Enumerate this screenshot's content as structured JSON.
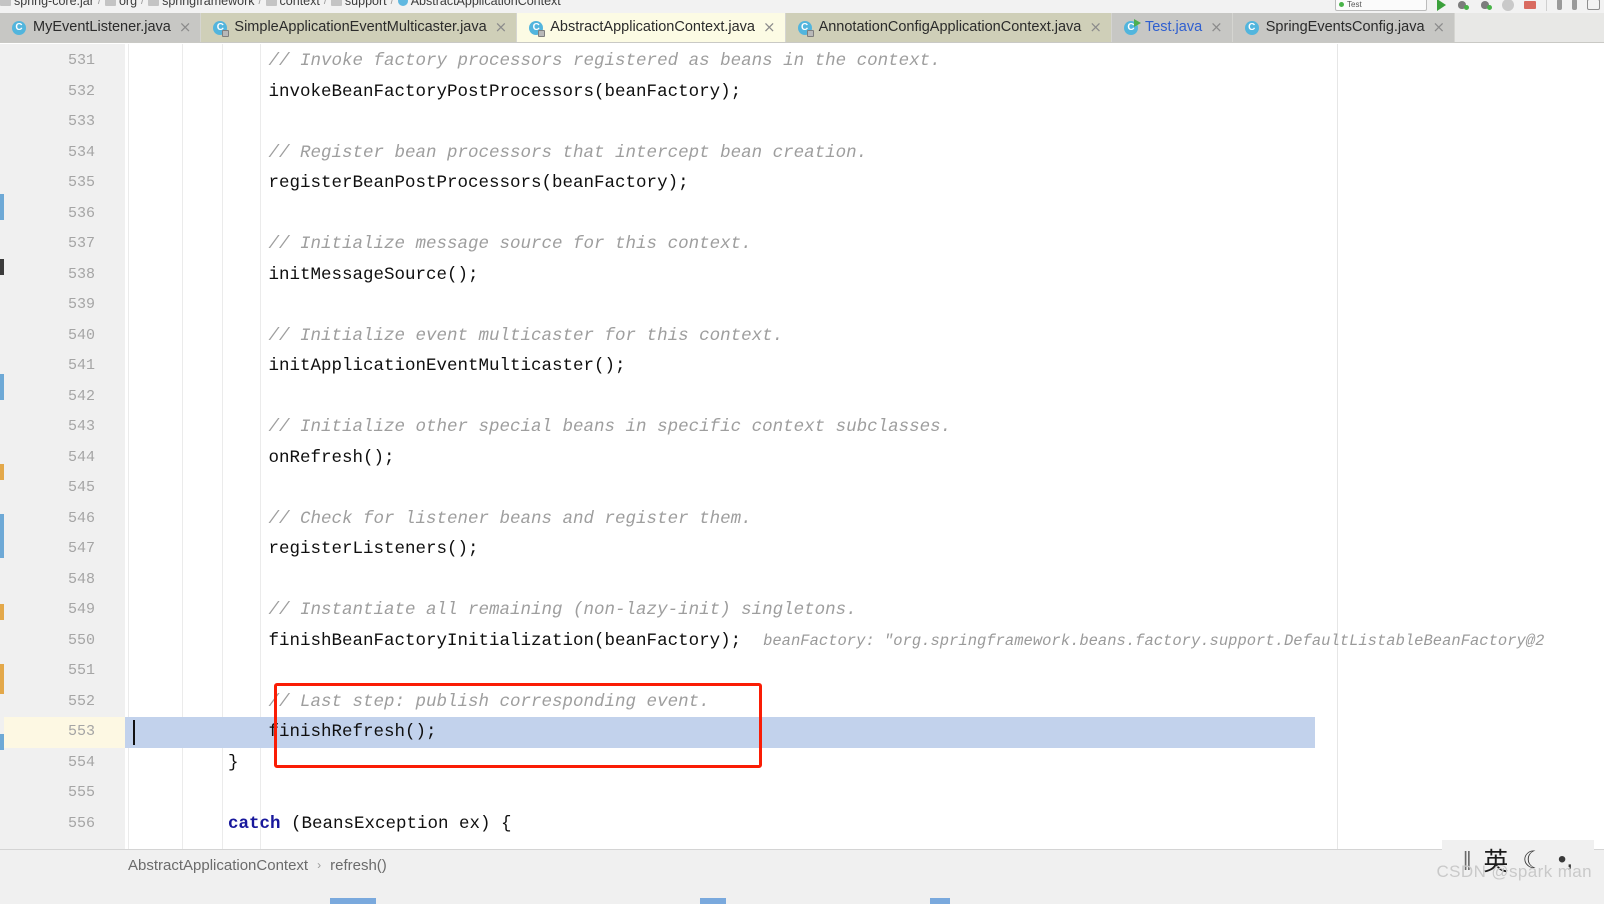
{
  "window": {
    "app": "IntelliJ IDEA",
    "top_breadcrumb": [
      {
        "label": "spring-core.jar",
        "icon": "jar-icon"
      },
      {
        "label": "org",
        "icon": "folder-icon"
      },
      {
        "label": "springframework",
        "icon": "folder-icon"
      },
      {
        "label": "context",
        "icon": "folder-icon"
      },
      {
        "label": "support",
        "icon": "folder-icon"
      },
      {
        "label": "AbstractApplicationContext",
        "icon": "class-icon"
      }
    ],
    "toolbar": {
      "run_config_label": "Test",
      "run_button": "run-icon",
      "debug_button": "debug-icon",
      "coverage_button": "coverage-icon",
      "profile_button": "profile-icon",
      "stop_button": "stop-icon",
      "pin_button": "pin-icon",
      "minimize_button": "minimize-icon",
      "layout_button": "layout-icon"
    }
  },
  "tabs": [
    {
      "label": "MyEventListener.java",
      "icon": "java-class-icon",
      "state": "inactive",
      "style": "gray",
      "is_test": false,
      "closable": true
    },
    {
      "label": "SimpleApplicationEventMulticaster.java",
      "icon": "java-class-locked-icon",
      "state": "inactive",
      "style": "olive",
      "is_test": false,
      "closable": true
    },
    {
      "label": "AbstractApplicationContext.java",
      "icon": "java-class-locked-icon",
      "state": "active",
      "style": "active",
      "is_test": false,
      "closable": true
    },
    {
      "label": "AnnotationConfigApplicationContext.java",
      "icon": "java-class-locked-icon",
      "state": "inactive",
      "style": "olive",
      "is_test": false,
      "closable": true
    },
    {
      "label": "Test.java",
      "icon": "java-test-class-icon",
      "state": "inactive",
      "style": "gray",
      "is_test": true,
      "closable": true
    },
    {
      "label": "SpringEventsConfig.java",
      "icon": "java-class-icon",
      "state": "inactive",
      "style": "gray",
      "is_test": false,
      "closable": true
    }
  ],
  "editor": {
    "first_line": 531,
    "caret_line": 553,
    "highlighted_line": 553,
    "colors": {
      "comment": "#9e9e9e",
      "keyword": "#18189c",
      "code": "#0f0f0f",
      "selection": "#c2d2ec",
      "gutter_highlight": "#fdf8e3",
      "annotation_red": "#fa1d05",
      "active_tab": "#fcfbe4"
    },
    "lines": [
      {
        "n": 531,
        "indent": 3,
        "text": "// Invoke factory processors registered as beans in the context.",
        "kind": "comment"
      },
      {
        "n": 532,
        "indent": 3,
        "text": "invokeBeanFactoryPostProcessors(beanFactory);",
        "kind": "code"
      },
      {
        "n": 533,
        "indent": 0,
        "text": "",
        "kind": "blank"
      },
      {
        "n": 534,
        "indent": 3,
        "text": "// Register bean processors that intercept bean creation.",
        "kind": "comment"
      },
      {
        "n": 535,
        "indent": 3,
        "text": "registerBeanPostProcessors(beanFactory);",
        "kind": "code"
      },
      {
        "n": 536,
        "indent": 0,
        "text": "",
        "kind": "blank"
      },
      {
        "n": 537,
        "indent": 3,
        "text": "// Initialize message source for this context.",
        "kind": "comment"
      },
      {
        "n": 538,
        "indent": 3,
        "text": "initMessageSource();",
        "kind": "code"
      },
      {
        "n": 539,
        "indent": 0,
        "text": "",
        "kind": "blank"
      },
      {
        "n": 540,
        "indent": 3,
        "text": "// Initialize event multicaster for this context.",
        "kind": "comment"
      },
      {
        "n": 541,
        "indent": 3,
        "text": "initApplicationEventMulticaster();",
        "kind": "code"
      },
      {
        "n": 542,
        "indent": 0,
        "text": "",
        "kind": "blank"
      },
      {
        "n": 543,
        "indent": 3,
        "text": "// Initialize other special beans in specific context subclasses.",
        "kind": "comment"
      },
      {
        "n": 544,
        "indent": 3,
        "text": "onRefresh();",
        "kind": "code"
      },
      {
        "n": 545,
        "indent": 0,
        "text": "",
        "kind": "blank"
      },
      {
        "n": 546,
        "indent": 3,
        "text": "// Check for listener beans and register them.",
        "kind": "comment"
      },
      {
        "n": 547,
        "indent": 3,
        "text": "registerListeners();",
        "kind": "code"
      },
      {
        "n": 548,
        "indent": 0,
        "text": "",
        "kind": "blank"
      },
      {
        "n": 549,
        "indent": 3,
        "text": "// Instantiate all remaining (non-lazy-init) singletons.",
        "kind": "comment"
      },
      {
        "n": 550,
        "indent": 3,
        "text": "finishBeanFactoryInitialization(beanFactory);",
        "kind": "code",
        "hint": "beanFactory: \"org.springframework.beans.factory.support.DefaultListableBeanFactory@2"
      },
      {
        "n": 551,
        "indent": 0,
        "text": "",
        "kind": "blank"
      },
      {
        "n": 552,
        "indent": 3,
        "text": "// Last step: publish corresponding event.",
        "kind": "comment"
      },
      {
        "n": 553,
        "indent": 3,
        "text": "finishRefresh();",
        "kind": "code"
      },
      {
        "n": 554,
        "indent": 2,
        "text": "}",
        "kind": "code"
      },
      {
        "n": 555,
        "indent": 0,
        "text": "",
        "kind": "blank"
      },
      {
        "n": 556,
        "indent": 2,
        "text": "catch (BeansException ex) {",
        "kind": "keyword-line",
        "keyword": "catch",
        "rest": " (BeansException ex) {"
      }
    ]
  },
  "annotations": [
    {
      "name": "code-highlight-box",
      "target": "lines 552-553"
    },
    {
      "name": "breadcrumb-highlight-box",
      "target": "bottom breadcrumb"
    }
  ],
  "breadcrumb": {
    "items": [
      "AbstractApplicationContext",
      "refresh()"
    ],
    "separator": "›"
  },
  "ime": {
    "bars": "||",
    "language": "英",
    "moon": "☾",
    "punct": "•,"
  },
  "watermark": "CSDN @spark man"
}
